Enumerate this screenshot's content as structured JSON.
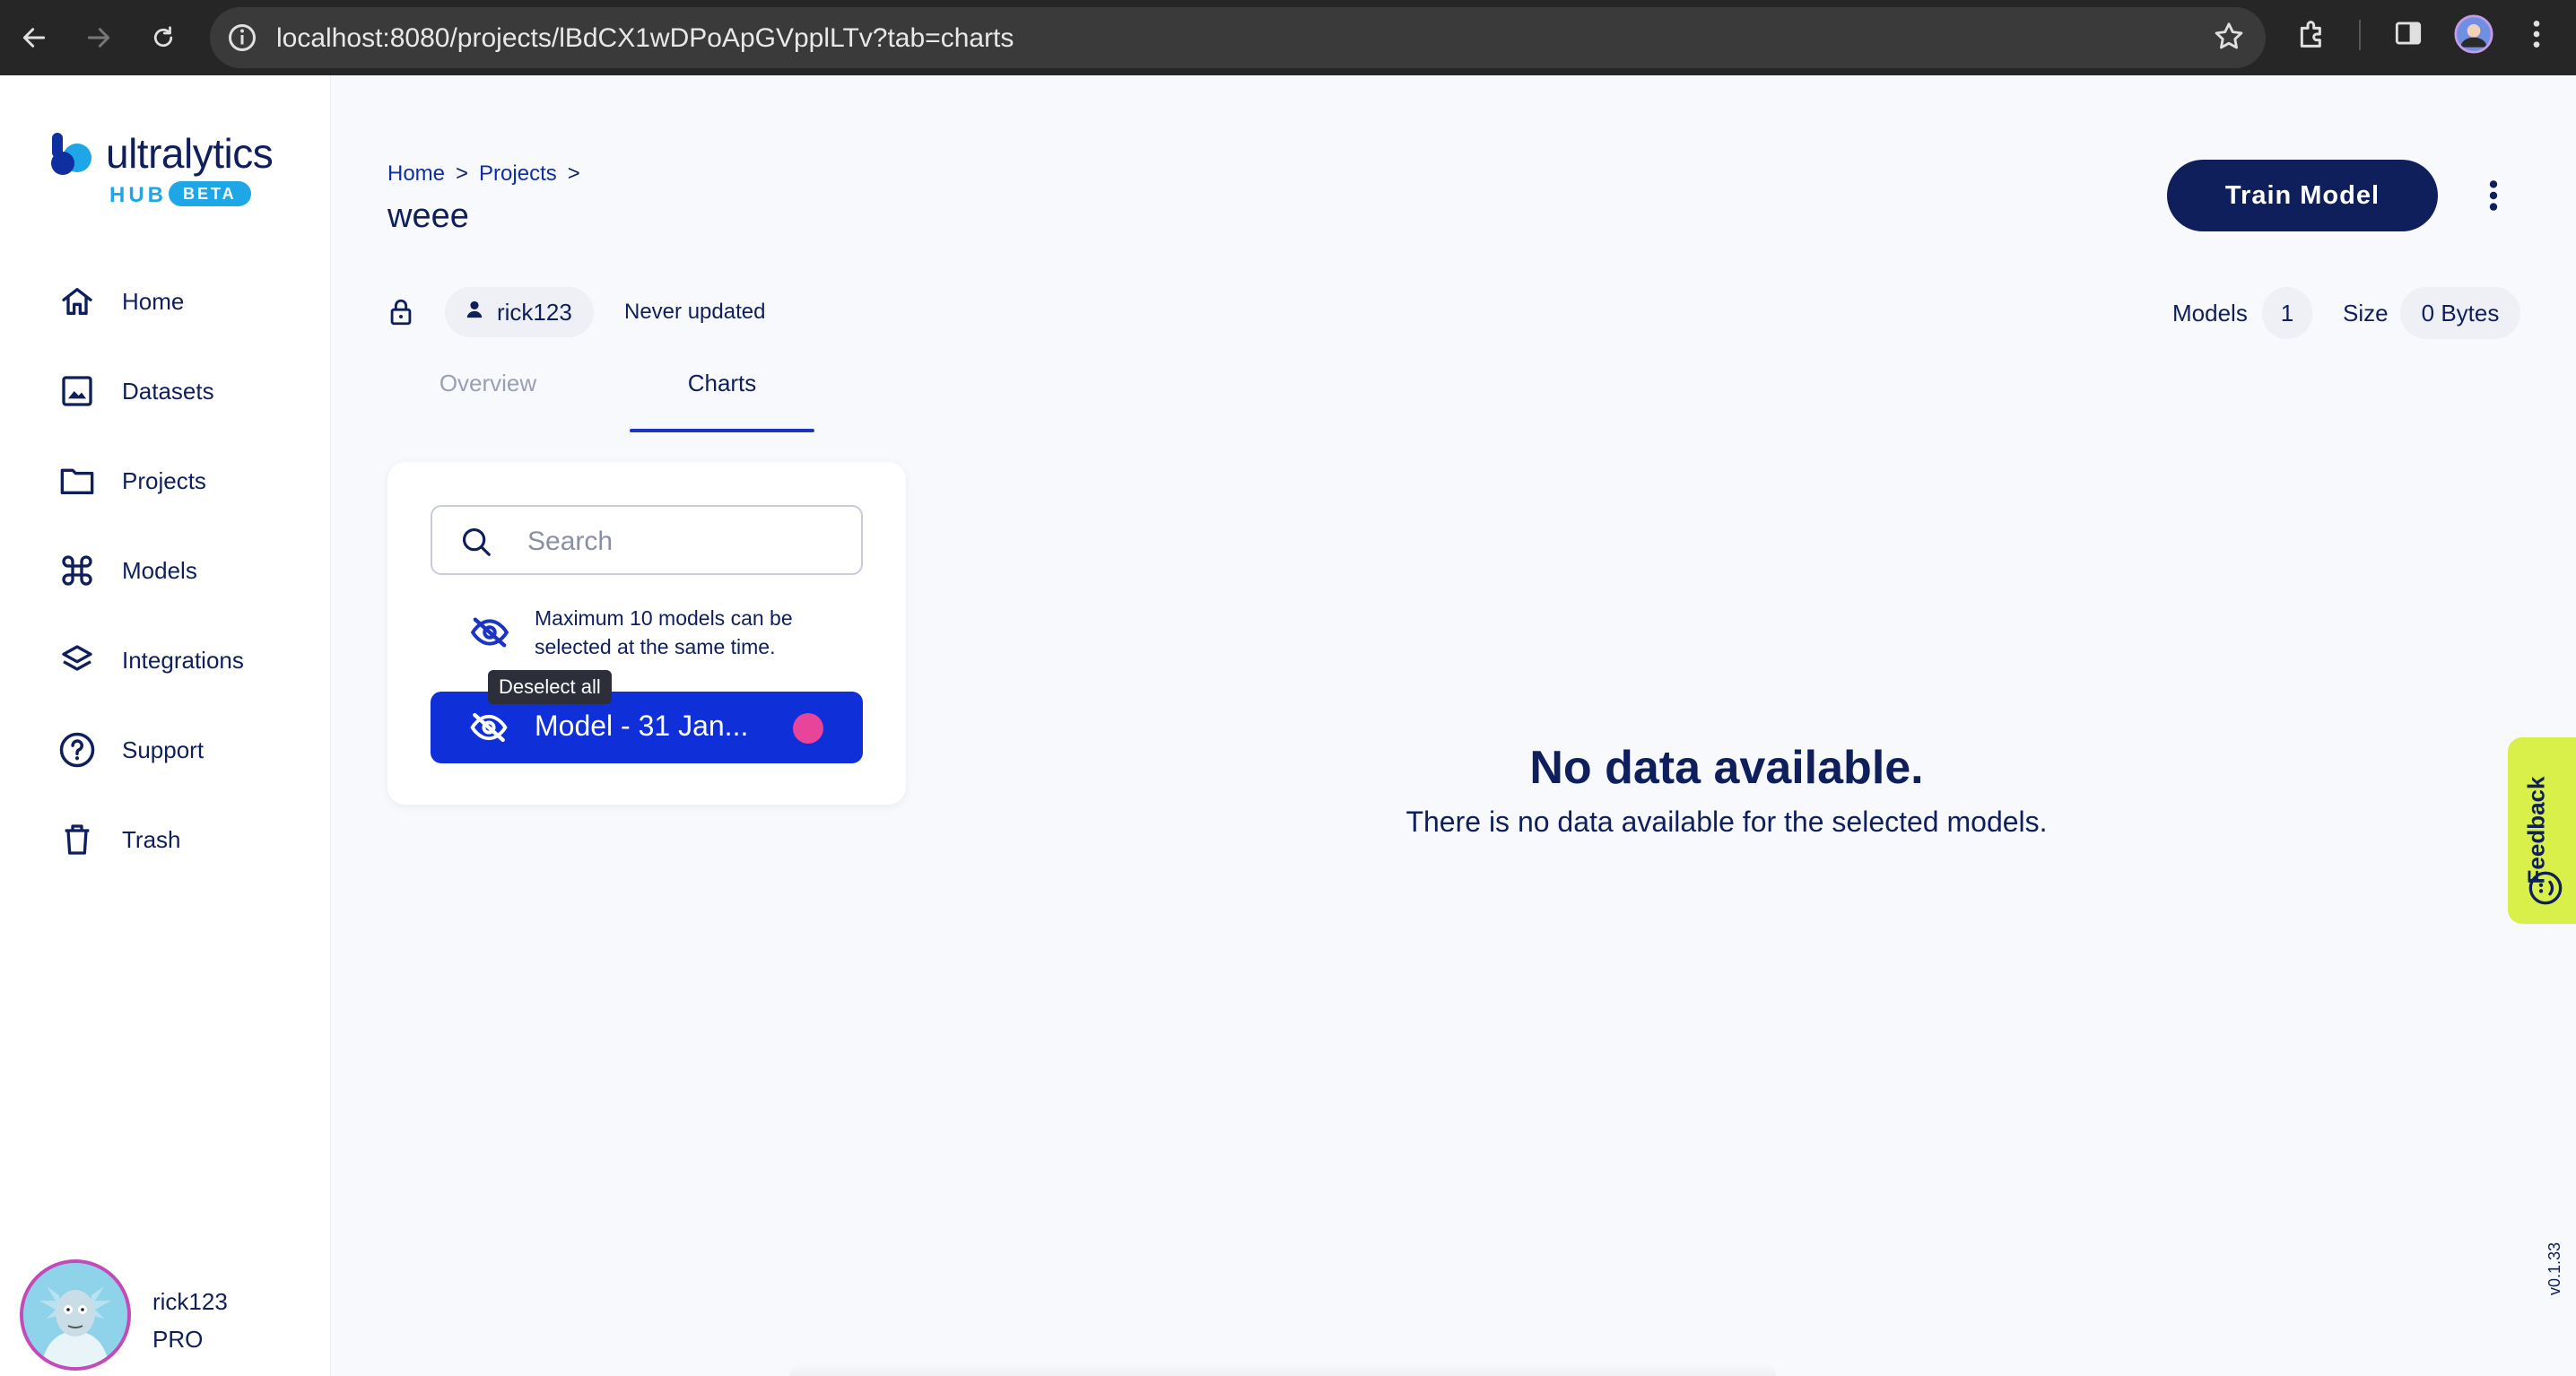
{
  "browser": {
    "url": "localhost:8080/projects/lBdCX1wDPoApGVpplLTv?tab=charts"
  },
  "sidebar": {
    "logo": {
      "word": "ultralytics",
      "hub": "HUB",
      "beta": "BETA"
    },
    "items": [
      {
        "label": "Home",
        "icon": "home-icon"
      },
      {
        "label": "Datasets",
        "icon": "image-icon"
      },
      {
        "label": "Projects",
        "icon": "folder-icon"
      },
      {
        "label": "Models",
        "icon": "command-icon"
      },
      {
        "label": "Integrations",
        "icon": "layers-icon"
      },
      {
        "label": "Support",
        "icon": "help-circle-icon"
      },
      {
        "label": "Trash",
        "icon": "trash-icon"
      }
    ],
    "user": {
      "name": "rick123",
      "plan": "PRO"
    }
  },
  "header": {
    "breadcrumb": [
      "Home",
      "Projects"
    ],
    "breadcrumb_sep": ">",
    "title": "weee",
    "train_button": "Train Model"
  },
  "meta": {
    "owner": "rick123",
    "updated": "Never updated",
    "models_label": "Models",
    "models_count": "1",
    "size_label": "Size",
    "size_value": "0 Bytes"
  },
  "tabs": [
    {
      "label": "Overview",
      "active": false
    },
    {
      "label": "Charts",
      "active": true
    }
  ],
  "panel": {
    "search_placeholder": "Search",
    "limit_note": "Maximum 10 models can be selected at the same time.",
    "tooltip": "Deselect all",
    "models": [
      {
        "name": "Model - 31 Jan...",
        "color": "#e8459a"
      }
    ]
  },
  "empty_state": {
    "title": "No data available.",
    "subtitle": "There is no data available for the selected models."
  },
  "feedback": {
    "label": "Feedback"
  },
  "version": "v0.1.33",
  "colors": {
    "primary": "#0f1f5c",
    "accent": "#0f2fd9",
    "feedback": "#d9f04a"
  }
}
